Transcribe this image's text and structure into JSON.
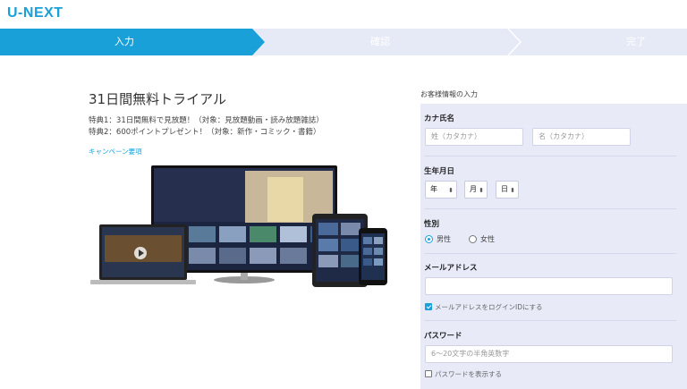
{
  "header": {
    "logo": "U-NEXT"
  },
  "steps": {
    "items": [
      "入力",
      "確認",
      "完了"
    ],
    "active_index": 0
  },
  "promo": {
    "title": "31日間無料トライアル",
    "perk1": "特典1：31日間無料で見放題！（対象：見放題動画・読み放題雑誌）",
    "perk2": "特典2：600ポイントプレゼント！（対象：新作・コミック・書籍）",
    "campaign_link": "キャンペーン要項"
  },
  "form": {
    "heading": "お客様情報の入力",
    "kana_name": {
      "label": "カナ氏名",
      "last_placeholder": "姓（カタカナ）",
      "first_placeholder": "名（カタカナ）"
    },
    "birthdate": {
      "label": "生年月日",
      "year": "年",
      "month": "月",
      "day": "日"
    },
    "gender": {
      "label": "性別",
      "male": "男性",
      "female": "女性",
      "selected": "男性"
    },
    "email": {
      "label": "メールアドレス",
      "value": "",
      "use_as_login_label": "メールアドレスをログインIDにする",
      "use_as_login_checked": true
    },
    "password": {
      "label": "パスワード",
      "placeholder": "6～20文字の半角英数字",
      "show_label": "パスワードを表示する",
      "show_checked": false
    }
  },
  "colors": {
    "accent": "#1aa0d8",
    "form_bg": "#e8eaf8",
    "steps_bg": "#e6eaf6"
  }
}
